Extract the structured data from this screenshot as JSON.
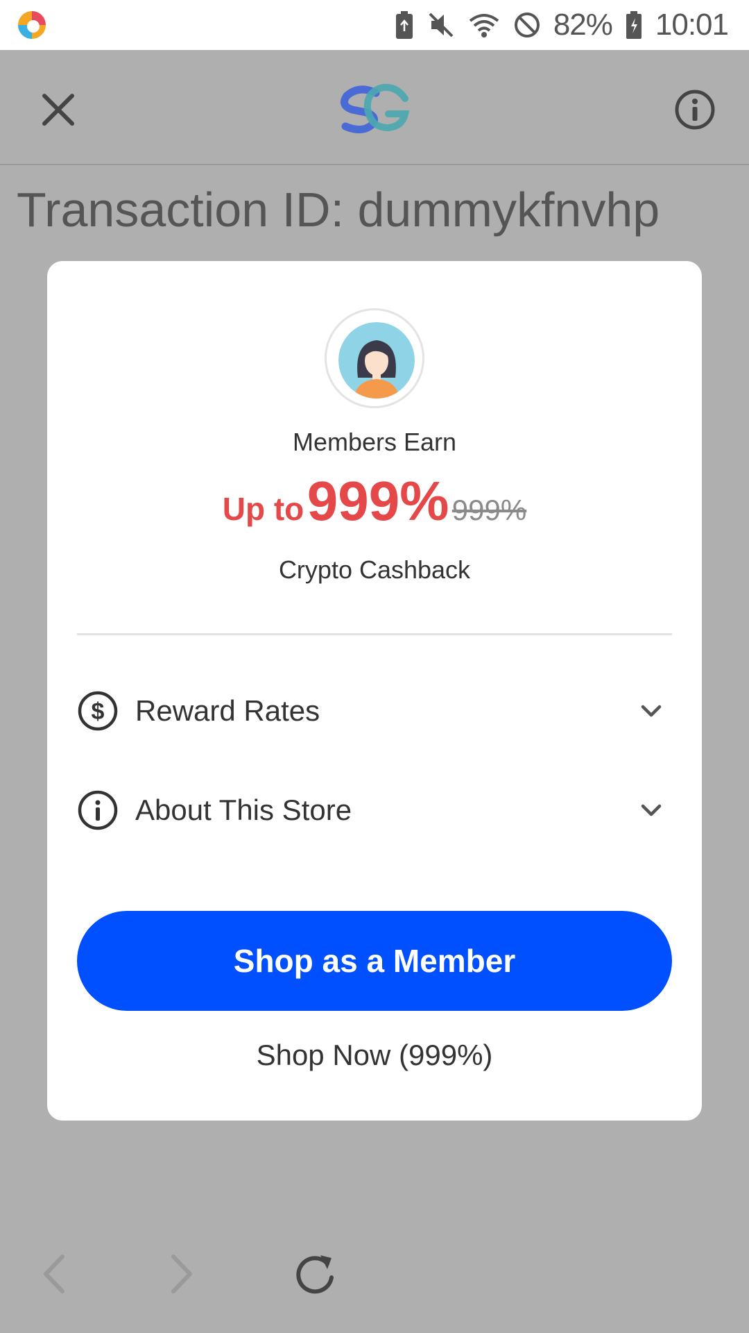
{
  "status_bar": {
    "battery_percent": "82%",
    "time": "10:01"
  },
  "app_bar": {
    "close_icon": "close-icon",
    "logo_icon": "brand-logo-icon",
    "info_icon": "info-icon"
  },
  "page": {
    "transaction_id": "Transaction ID: dummykfnvhp"
  },
  "modal": {
    "members_earn": "Members Earn",
    "rate_prefix": "Up to",
    "rate_value": "999%",
    "rate_old": "999%",
    "cashback_label": "Crypto Cashback",
    "rows": [
      {
        "label": "Reward Rates",
        "icon": "dollar-circle-icon"
      },
      {
        "label": "About This Store",
        "icon": "info-circle-icon"
      }
    ],
    "primary_button": "Shop as a Member",
    "secondary_link": "Shop Now (999%)"
  },
  "colors": {
    "accent_blue": "#0050ff",
    "rate_red": "#e54848",
    "overlay_gray": "#afafaf"
  },
  "bottom_nav": {
    "back_icon": "chevron-left-icon",
    "forward_icon": "chevron-right-icon",
    "reload_icon": "reload-icon"
  }
}
